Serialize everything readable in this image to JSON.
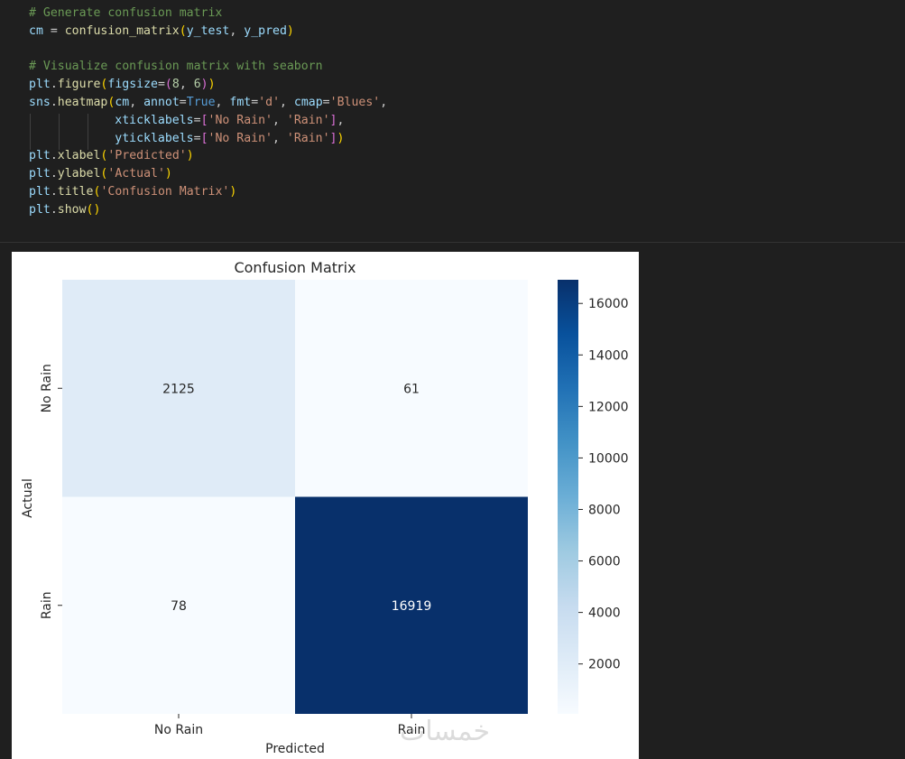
{
  "code": {
    "colors": {
      "comment": "#6a9955",
      "keyword": "#569cd6",
      "variable": "#9cdcfe",
      "function": "#dcdcaa",
      "string": "#ce9178",
      "number": "#b5cea8",
      "plain": "#cccccc",
      "bracket1": "#ffd700",
      "bracket2": "#da70d6"
    },
    "lines": [
      [
        {
          "t": "# Generate confusion matrix",
          "c": "comment"
        }
      ],
      [
        {
          "t": "cm",
          "c": "variable"
        },
        {
          "t": " = ",
          "c": "plain"
        },
        {
          "t": "confusion_matrix",
          "c": "function"
        },
        {
          "t": "(",
          "c": "bracket1"
        },
        {
          "t": "y_test",
          "c": "variable"
        },
        {
          "t": ", ",
          "c": "plain"
        },
        {
          "t": "y_pred",
          "c": "variable"
        },
        {
          "t": ")",
          "c": "bracket1"
        }
      ],
      [],
      [
        {
          "t": "# Visualize confusion matrix with seaborn",
          "c": "comment"
        }
      ],
      [
        {
          "t": "plt",
          "c": "variable"
        },
        {
          "t": ".",
          "c": "plain"
        },
        {
          "t": "figure",
          "c": "function"
        },
        {
          "t": "(",
          "c": "bracket1"
        },
        {
          "t": "figsize",
          "c": "variable"
        },
        {
          "t": "=",
          "c": "plain"
        },
        {
          "t": "(",
          "c": "bracket2"
        },
        {
          "t": "8",
          "c": "number"
        },
        {
          "t": ", ",
          "c": "plain"
        },
        {
          "t": "6",
          "c": "number"
        },
        {
          "t": ")",
          "c": "bracket2"
        },
        {
          "t": ")",
          "c": "bracket1"
        }
      ],
      [
        {
          "t": "sns",
          "c": "variable"
        },
        {
          "t": ".",
          "c": "plain"
        },
        {
          "t": "heatmap",
          "c": "function"
        },
        {
          "t": "(",
          "c": "bracket1"
        },
        {
          "t": "cm",
          "c": "variable"
        },
        {
          "t": ", ",
          "c": "plain"
        },
        {
          "t": "annot",
          "c": "variable"
        },
        {
          "t": "=",
          "c": "plain"
        },
        {
          "t": "True",
          "c": "keyword"
        },
        {
          "t": ", ",
          "c": "plain"
        },
        {
          "t": "fmt",
          "c": "variable"
        },
        {
          "t": "=",
          "c": "plain"
        },
        {
          "t": "'d'",
          "c": "string"
        },
        {
          "t": ", ",
          "c": "plain"
        },
        {
          "t": "cmap",
          "c": "variable"
        },
        {
          "t": "=",
          "c": "plain"
        },
        {
          "t": "'Blues'",
          "c": "string"
        },
        {
          "t": ",",
          "c": "plain"
        }
      ],
      [
        {
          "t": "            ",
          "c": "plain"
        },
        {
          "t": "xticklabels",
          "c": "variable"
        },
        {
          "t": "=",
          "c": "plain"
        },
        {
          "t": "[",
          "c": "bracket2"
        },
        {
          "t": "'No Rain'",
          "c": "string"
        },
        {
          "t": ", ",
          "c": "plain"
        },
        {
          "t": "'Rain'",
          "c": "string"
        },
        {
          "t": "]",
          "c": "bracket2"
        },
        {
          "t": ",",
          "c": "plain"
        }
      ],
      [
        {
          "t": "            ",
          "c": "plain"
        },
        {
          "t": "yticklabels",
          "c": "variable"
        },
        {
          "t": "=",
          "c": "plain"
        },
        {
          "t": "[",
          "c": "bracket2"
        },
        {
          "t": "'No Rain'",
          "c": "string"
        },
        {
          "t": ", ",
          "c": "plain"
        },
        {
          "t": "'Rain'",
          "c": "string"
        },
        {
          "t": "]",
          "c": "bracket2"
        },
        {
          "t": ")",
          "c": "bracket1"
        }
      ],
      [
        {
          "t": "plt",
          "c": "variable"
        },
        {
          "t": ".",
          "c": "plain"
        },
        {
          "t": "xlabel",
          "c": "function"
        },
        {
          "t": "(",
          "c": "bracket1"
        },
        {
          "t": "'Predicted'",
          "c": "string"
        },
        {
          "t": ")",
          "c": "bracket1"
        }
      ],
      [
        {
          "t": "plt",
          "c": "variable"
        },
        {
          "t": ".",
          "c": "plain"
        },
        {
          "t": "ylabel",
          "c": "function"
        },
        {
          "t": "(",
          "c": "bracket1"
        },
        {
          "t": "'Actual'",
          "c": "string"
        },
        {
          "t": ")",
          "c": "bracket1"
        }
      ],
      [
        {
          "t": "plt",
          "c": "variable"
        },
        {
          "t": ".",
          "c": "plain"
        },
        {
          "t": "title",
          "c": "function"
        },
        {
          "t": "(",
          "c": "bracket1"
        },
        {
          "t": "'Confusion Matrix'",
          "c": "string"
        },
        {
          "t": ")",
          "c": "bracket1"
        }
      ],
      [
        {
          "t": "plt",
          "c": "variable"
        },
        {
          "t": ".",
          "c": "plain"
        },
        {
          "t": "show",
          "c": "function"
        },
        {
          "t": "(",
          "c": "bracket1"
        },
        {
          "t": ")",
          "c": "bracket1"
        }
      ]
    ]
  },
  "chart_data": {
    "type": "heatmap",
    "title": "Confusion Matrix",
    "xlabel": "Predicted",
    "ylabel": "Actual",
    "x_categories": [
      "No Rain",
      "Rain"
    ],
    "y_categories": [
      "No Rain",
      "Rain"
    ],
    "values": [
      [
        2125,
        61
      ],
      [
        78,
        16919
      ]
    ],
    "colormap": "Blues",
    "colorbar": {
      "vmin": 61,
      "vmax": 16919,
      "ticks": [
        2000,
        4000,
        6000,
        8000,
        10000,
        12000,
        14000,
        16000
      ]
    },
    "annot_colors": {
      "light": "#262626",
      "dark": "#ffffff"
    },
    "grid": false
  },
  "watermark": "خمسات"
}
